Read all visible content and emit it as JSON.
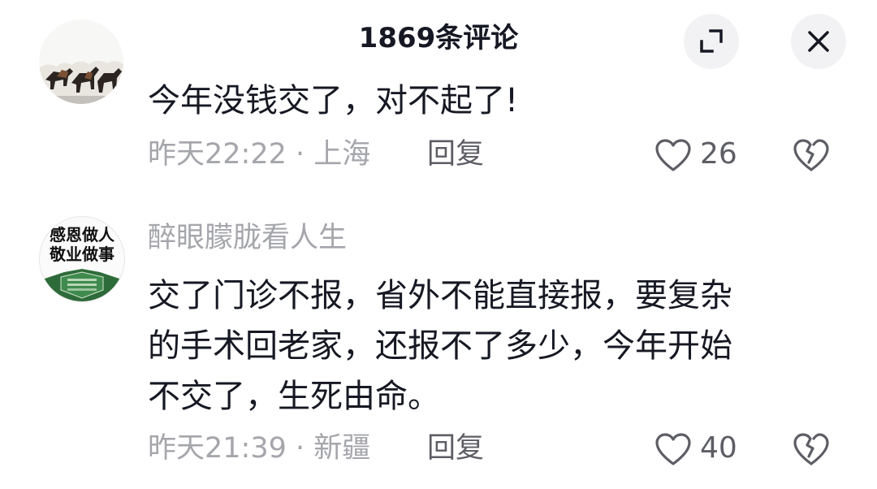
{
  "header": {
    "title": "1869条评论"
  },
  "comments": [
    {
      "avatar_icon": "horses-avatar-icon",
      "text_lines": [
        "今年没钱交了，对不起了!"
      ],
      "meta": "昨天22:22 · 上海",
      "reply_label": "回复",
      "likes": "26"
    },
    {
      "username": "醉眼朦胧看人生",
      "avatar_text": [
        "感恩做人",
        "敬业做事"
      ],
      "text_lines": [
        "交了门诊不报，省外不能直接报，要复杂",
        "的手术回老家，还报不了多少，今年开始",
        "不交了，生死由命。"
      ],
      "meta": "昨天21:39 · 新疆",
      "reply_label": "回复",
      "likes": "40"
    }
  ],
  "colors": {
    "primary_text": "#161823",
    "secondary_text": "#a5a6ab",
    "action_text": "#5d5e65"
  }
}
